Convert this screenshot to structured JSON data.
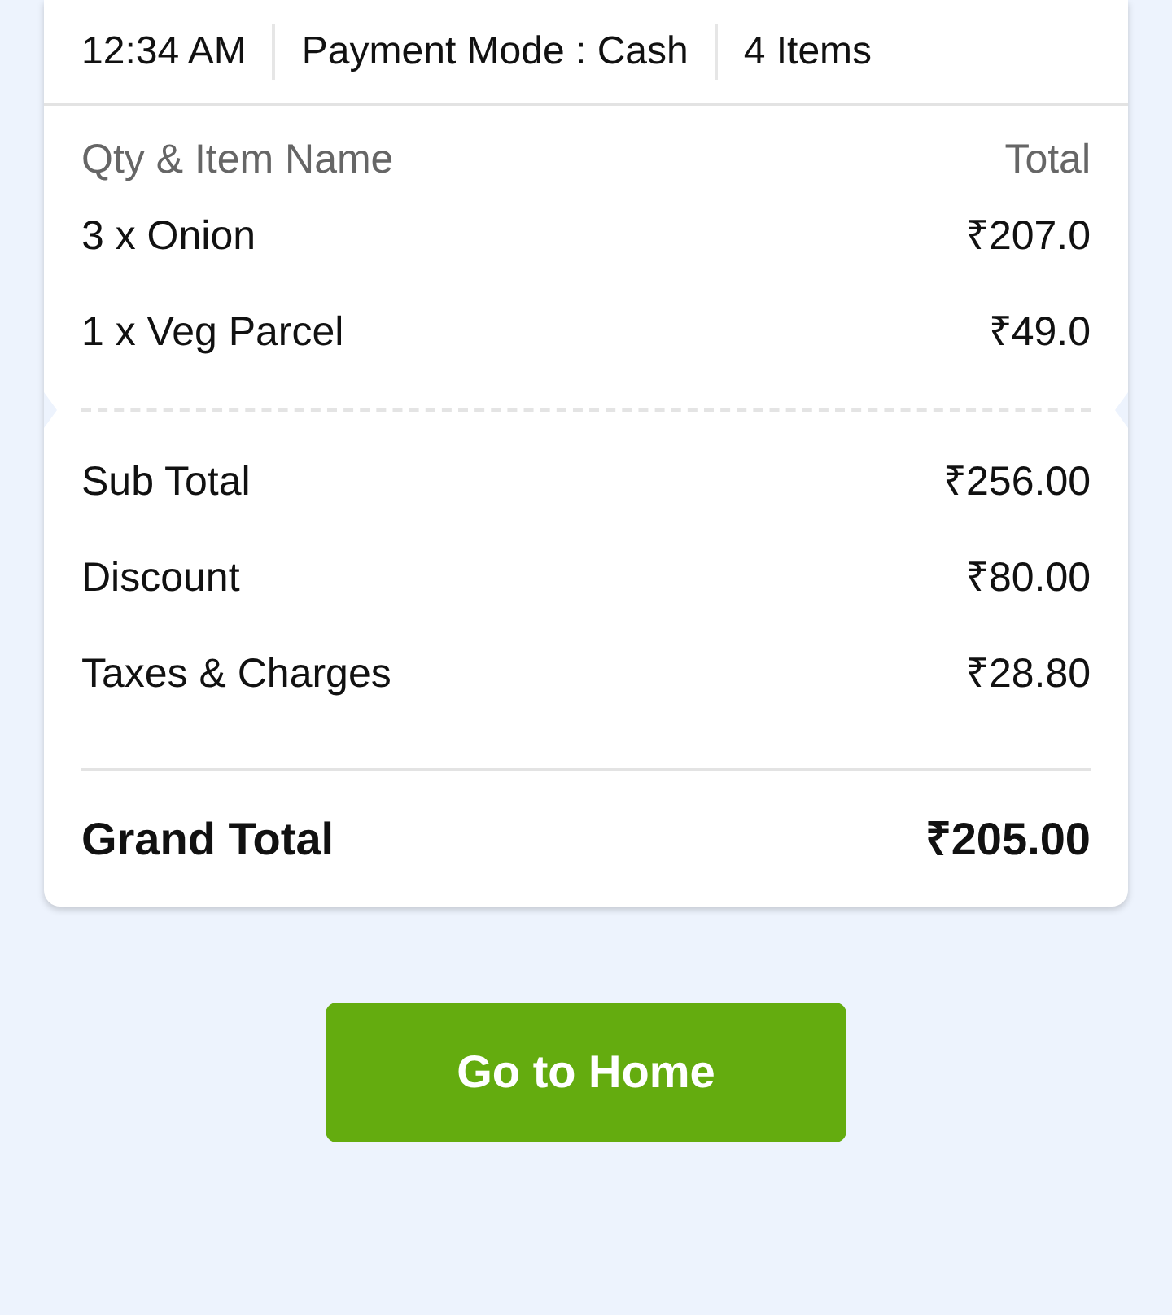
{
  "header": {
    "time": "12:34 AM",
    "payment_mode": "Payment Mode : Cash",
    "item_count": "4 Items"
  },
  "items_table": {
    "columns": [
      "Qty & Item Name",
      "Total"
    ],
    "rows": [
      {
        "item": "3 x Onion",
        "total": "₹207.0"
      },
      {
        "item": "1 x Veg Parcel",
        "total": "₹49.0"
      }
    ]
  },
  "summary": [
    {
      "label": "Sub Total",
      "value": "₹256.00"
    },
    {
      "label": "Discount",
      "value": "₹80.00"
    },
    {
      "label": "Taxes & Charges",
      "value": "₹28.80"
    }
  ],
  "grand_total": {
    "label": "Grand Total",
    "value": "₹205.00"
  },
  "button": {
    "label": "Go to Home"
  }
}
